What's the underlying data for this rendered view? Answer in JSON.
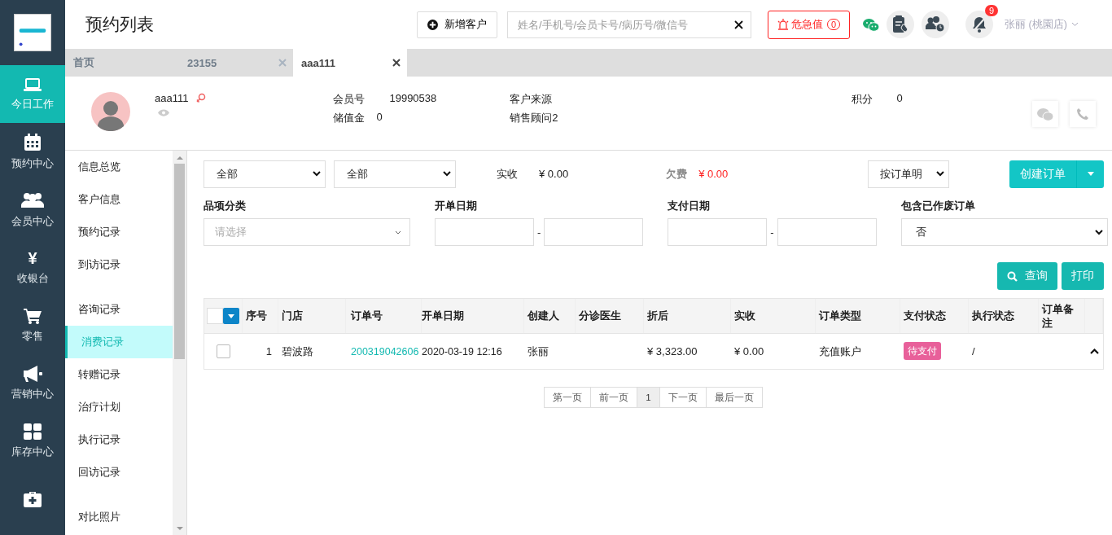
{
  "header": {
    "title": "预约列表",
    "new_customer_button": "新增客户",
    "search": {
      "placeholder": "姓名/手机号/会员卡号/病历号/微信号"
    },
    "alarm": {
      "label": "危急值",
      "count": "0"
    },
    "notification_badge": "9",
    "user": "张丽 (桃園店)"
  },
  "nav": [
    {
      "kind": "laptop",
      "label": "今日工作",
      "selected": true
    },
    {
      "kind": "calendar",
      "label": "预约中心",
      "selected": false
    },
    {
      "kind": "users",
      "label": "会员中心",
      "selected": false
    },
    {
      "kind": "glyph",
      "glyph": "¥",
      "label": "收银台",
      "selected": false
    },
    {
      "kind": "cart",
      "label": "零售",
      "selected": false
    },
    {
      "kind": "megaphone",
      "label": "营销中心",
      "selected": false
    },
    {
      "kind": "grid",
      "label": "库存中心",
      "selected": false
    },
    {
      "kind": "medkit",
      "selected": false
    }
  ],
  "tabs": [
    {
      "label": "首页",
      "selected": false,
      "closable": false
    },
    {
      "label": "23155",
      "selected": false,
      "closable": true
    },
    {
      "label": "aaa111",
      "selected": true,
      "closable": true
    }
  ],
  "customer": {
    "name": "aaa111",
    "member_no_label": "会员号",
    "member_no": "19990538",
    "balance_label": "储值金",
    "balance": "0",
    "source_label": "客户来源",
    "consultant": "销售顾问2",
    "points_label": "积分",
    "points": "0"
  },
  "side_menu": [
    [
      {
        "label": "信息总览",
        "selected": false
      },
      {
        "label": "客户信息",
        "selected": false
      },
      {
        "label": "预约记录",
        "selected": false
      },
      {
        "label": "到访记录",
        "selected": false
      }
    ],
    [
      {
        "label": "咨询记录",
        "selected": false
      },
      {
        "label": "消费记录",
        "selected": true
      },
      {
        "label": "转赠记录",
        "selected": false
      },
      {
        "label": "治疗计划",
        "selected": false
      },
      {
        "label": "执行记录",
        "selected": false
      },
      {
        "label": "回访记录",
        "selected": false
      }
    ],
    [
      {
        "label": "对比照片",
        "selected": false
      }
    ]
  ],
  "filters": {
    "select_1": "全部",
    "select_2": "全部",
    "received_label": "实收",
    "received": "¥ 0.00",
    "owed_label": "欠费",
    "owed": "¥ 0.00",
    "view_select": "按订单明",
    "create_button": "创建订单",
    "category": {
      "label": "品项分类",
      "placeholder": "请选择"
    },
    "order_date_label": "开单日期",
    "pay_date_label": "支付日期",
    "date_separator": "-",
    "voided": {
      "label": "包含已作废订单",
      "value": "否"
    },
    "query_button": "查询",
    "print_button": "打印"
  },
  "table": {
    "columns": [
      "序号",
      "门店",
      "订单号",
      "开单日期",
      "创建人",
      "分诊医生",
      "折后",
      "实收",
      "订单类型",
      "支付状态",
      "执行状态",
      "订单备注"
    ],
    "rows": [
      {
        "checked": false,
        "index": "1",
        "store": "碧波路",
        "order_no": "200319042606",
        "date": "2020-03-19 12:16",
        "creator": "张丽",
        "discounted": "¥ 3,323.00",
        "received": "¥ 0.00",
        "type": "充值账户",
        "pay_status": "待支付",
        "exec_status": "/"
      }
    ]
  },
  "pagination": [
    {
      "label": "第一页",
      "selected": false
    },
    {
      "label": "前一页",
      "selected": false
    },
    {
      "label": "1",
      "selected": true
    },
    {
      "label": "下一页",
      "selected": false
    },
    {
      "label": "最后一页",
      "selected": false
    }
  ]
}
